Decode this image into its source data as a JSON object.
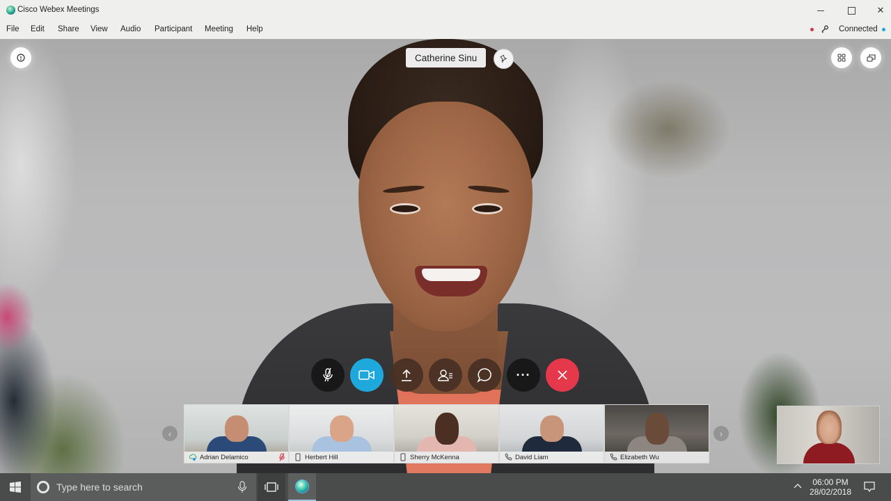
{
  "window": {
    "title": "Cisco Webex Meetings",
    "controls": {
      "minimize": "minimize",
      "maximize": "maximize",
      "close": "✕"
    }
  },
  "menu": {
    "items": [
      "File",
      "Edit",
      "Share",
      "View",
      "Audio",
      "Participant",
      "Meeting",
      "Help"
    ]
  },
  "status": {
    "connection_label": "Connected",
    "recording_color": "#d4374a",
    "connected_color": "#25a6d9"
  },
  "stage": {
    "active_speaker": "Catherine Sinu",
    "icons": {
      "info": "info-icon",
      "pin": "pin-icon",
      "layout": "grid-layout-icon",
      "popout": "popout-icon"
    }
  },
  "controls": [
    {
      "name": "mute",
      "icon": "microphone-muted-icon",
      "color": "#161616"
    },
    {
      "name": "video",
      "icon": "video-camera-icon",
      "color": "#1fa8dc"
    },
    {
      "name": "share",
      "icon": "share-upload-icon",
      "color": "#46302a"
    },
    {
      "name": "participants",
      "icon": "participants-icon",
      "color": "#46302a"
    },
    {
      "name": "chat",
      "icon": "chat-bubble-icon",
      "color": "#46302a"
    },
    {
      "name": "more",
      "icon": "more-dots-icon",
      "label": "···",
      "color": "#161616"
    },
    {
      "name": "end",
      "icon": "close-x-icon",
      "color": "#e5384a"
    }
  ],
  "filmstrip": {
    "prev": "‹",
    "next": "›",
    "participants": [
      {
        "name": "Adrian Delamico",
        "device": "cloud-computer-icon",
        "muted": true
      },
      {
        "name": "Herbert Hill",
        "device": "mobile-phone-icon",
        "muted": false
      },
      {
        "name": "Sherry McKenna",
        "device": "mobile-phone-icon",
        "muted": false
      },
      {
        "name": "David Liam",
        "device": "phone-handset-icon",
        "muted": false
      },
      {
        "name": "Elizabeth Wu",
        "device": "phone-handset-icon",
        "muted": false
      }
    ]
  },
  "taskbar": {
    "search_placeholder": "Type here to search",
    "time": "06:00 PM",
    "date": "28/02/2018"
  }
}
